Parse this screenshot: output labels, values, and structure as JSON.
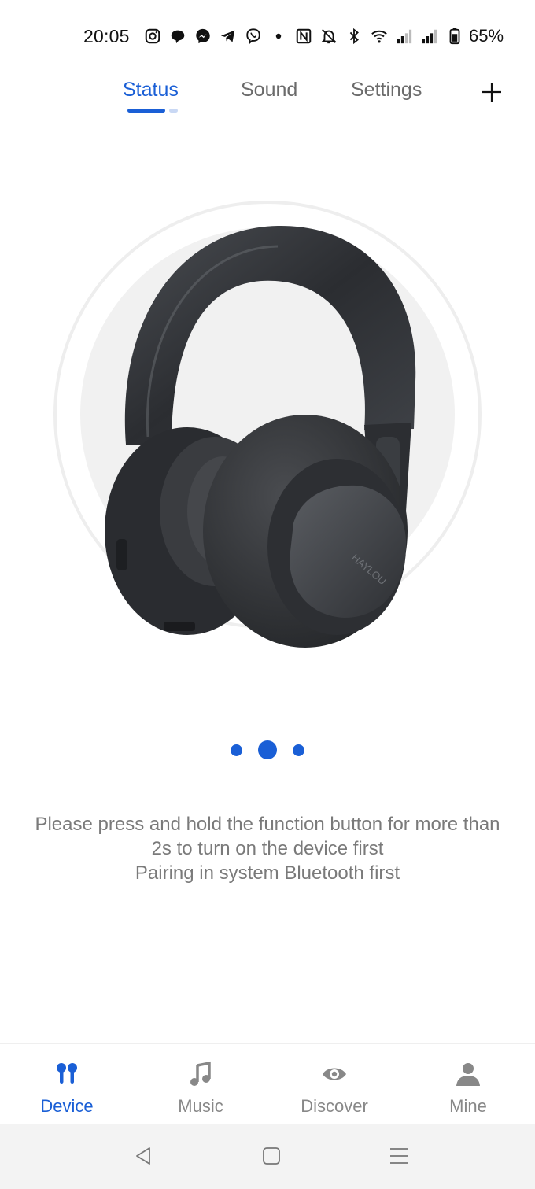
{
  "status_bar": {
    "time": "20:05",
    "icons": [
      "instagram-icon",
      "chat-bubble-icon",
      "messenger-icon",
      "telegram-icon",
      "viber-icon",
      "dot-icon",
      "nfc-icon",
      "bell-off-icon",
      "bluetooth-icon",
      "wifi-icon",
      "signal-icon",
      "signal-icon",
      "battery-icon"
    ],
    "battery": "65%"
  },
  "tabs": [
    {
      "label": "Status",
      "active": true
    },
    {
      "label": "Sound",
      "active": false
    },
    {
      "label": "Settings",
      "active": false
    }
  ],
  "add_icon": "plus-icon",
  "product": {
    "brand_mark": "HAYLOU"
  },
  "carousel": {
    "count": 3,
    "active_index": 1
  },
  "instructions": {
    "line1": "Please press and hold the function button for more than",
    "line2": "2s to turn on the device first",
    "line3": "Pairing in system Bluetooth first"
  },
  "bottom_nav": [
    {
      "label": "Device",
      "icon": "earbuds-icon",
      "active": true
    },
    {
      "label": "Music",
      "icon": "music-note-icon",
      "active": false
    },
    {
      "label": "Discover",
      "icon": "eye-icon",
      "active": false
    },
    {
      "label": "Mine",
      "icon": "person-icon",
      "active": false
    }
  ],
  "system_nav": [
    "back-icon",
    "home-icon",
    "recents-icon"
  ],
  "colors": {
    "accent": "#1a5fd6",
    "inactive": "#888888",
    "text_muted": "#7a7a7a"
  }
}
